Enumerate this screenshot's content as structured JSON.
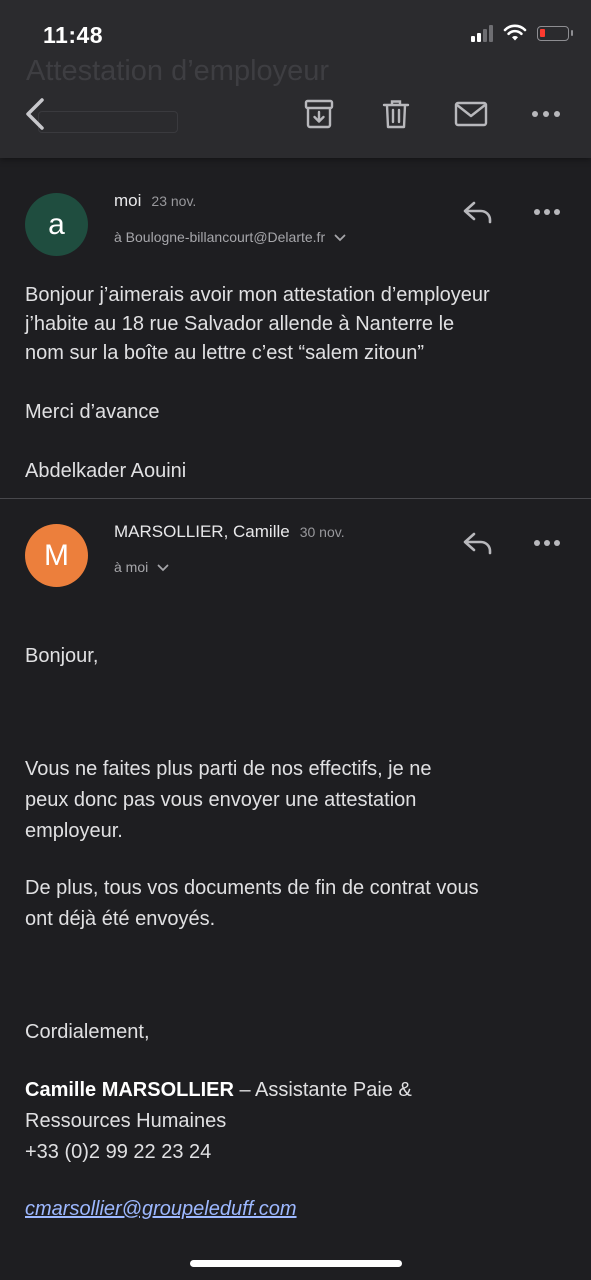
{
  "status_bar": {
    "time": "11:48"
  },
  "toolbar": {
    "ghost_subject": "Attestation d’employeur"
  },
  "messages": [
    {
      "avatar_letter": "a",
      "avatar_color": "#1f4d3f",
      "sender": "moi",
      "date": "23 nov.",
      "recipient": "à Boulogne-billancourt@Delarte.fr",
      "body": [
        "Bonjour j’aimerais avoir mon attestation d’employeur",
        "j’habite au 18 rue Salvador allende à Nanterre le",
        "nom sur la boîte au lettre c’est “salem zitoun”",
        "Merci d’avance",
        "Abdelkader Aouini"
      ]
    },
    {
      "avatar_letter": "M",
      "avatar_color": "#ec7f3c",
      "sender": "MARSOLLIER, Camille",
      "date": "30 nov.",
      "recipient": "à moi",
      "body": [
        "Bonjour,",
        "Vous ne faites plus parti de nos effectifs, je ne",
        "peux donc pas vous envoyer une attestation",
        "employeur.",
        "De plus, tous vos documents de fin de contrat vous",
        "ont déjà été envoyés.",
        "Cordialement,"
      ],
      "signature": {
        "name": "Camille MARSOLLIER",
        "role_line1": " – Assistante Paie &",
        "role_line2": "Ressources Humaines",
        "phone": "+33 (0)2 99 22 23 24",
        "email": "cmarsollier@groupeleduff.com"
      }
    }
  ]
}
